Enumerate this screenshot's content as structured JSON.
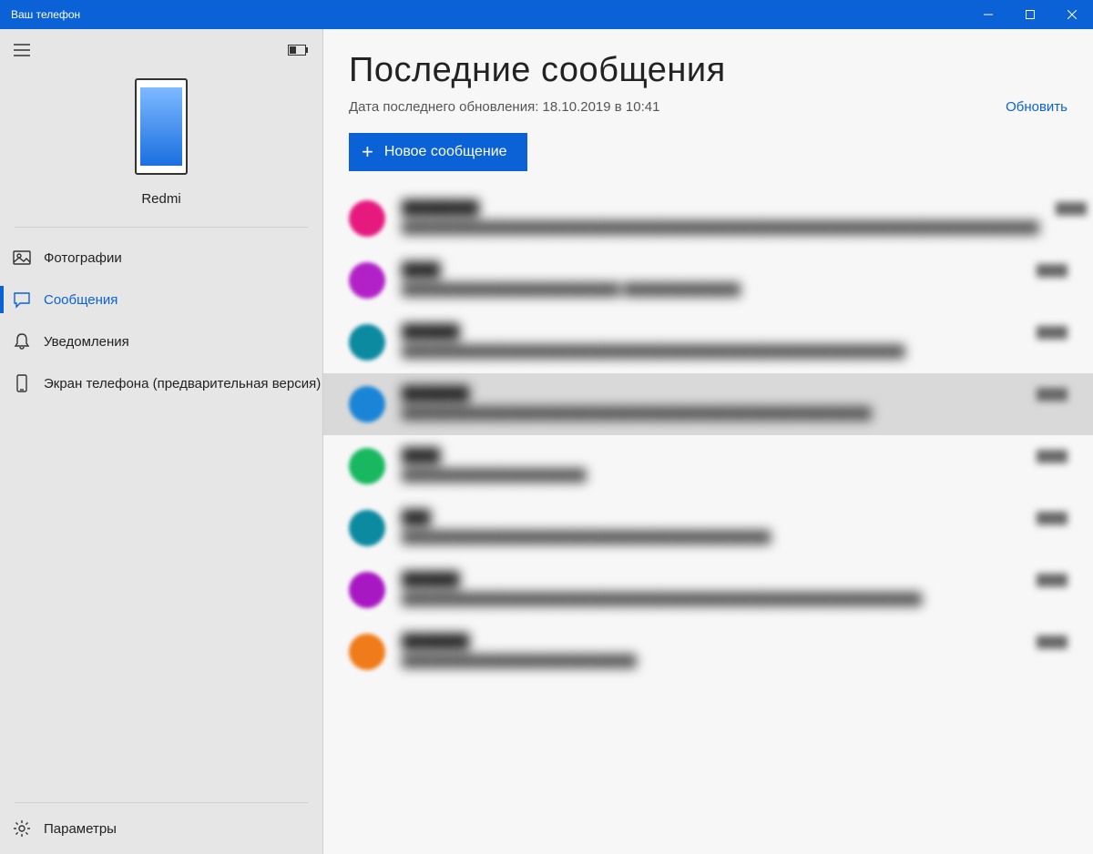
{
  "titlebar": {
    "title": "Ваш телефон"
  },
  "sidebar": {
    "phone_name": "Redmi",
    "nav": [
      {
        "id": "photos",
        "label": "Фотографии",
        "active": false
      },
      {
        "id": "messages",
        "label": "Сообщения",
        "active": true
      },
      {
        "id": "notifications",
        "label": "Уведомления",
        "active": false
      },
      {
        "id": "phone-screen",
        "label": "Экран телефона (предварительная версия)",
        "active": false
      }
    ],
    "settings_label": "Параметры"
  },
  "content": {
    "title": "Последние сообщения",
    "last_updated": "Дата последнего обновления: 18.10.2019 в 10:41",
    "refresh_label": "Обновить",
    "new_message_label": "Новое сообщение"
  },
  "messages": [
    {
      "color": "#e6197f",
      "name": "████████",
      "preview": "████████████████████████████████████████████████████████████████████████████",
      "time": "████",
      "selected": false
    },
    {
      "color": "#b221c7",
      "name": "████",
      "preview": "██████████████████████████\n██████████████",
      "time": "████",
      "selected": false
    },
    {
      "color": "#0b8aa0",
      "name": "██████",
      "preview": "████████████████████████████████████████████████████████████",
      "time": "████",
      "selected": false
    },
    {
      "color": "#1a85d6",
      "name": "███████",
      "preview": "████████████████████████████████████████████████████████",
      "time": "████",
      "selected": true
    },
    {
      "color": "#17b85f",
      "name": "████",
      "preview": "██████████████████████",
      "time": "████",
      "selected": false
    },
    {
      "color": "#0b8aa0",
      "name": "███",
      "preview": "████████████████████████████████████████████",
      "time": "████",
      "selected": false
    },
    {
      "color": "#a818c2",
      "name": "██████",
      "preview": "██████████████████████████████████████████████████████████████",
      "time": "████",
      "selected": false
    },
    {
      "color": "#f07b1a",
      "name": "███████",
      "preview": "████████████████████████████",
      "time": "████",
      "selected": false
    }
  ]
}
